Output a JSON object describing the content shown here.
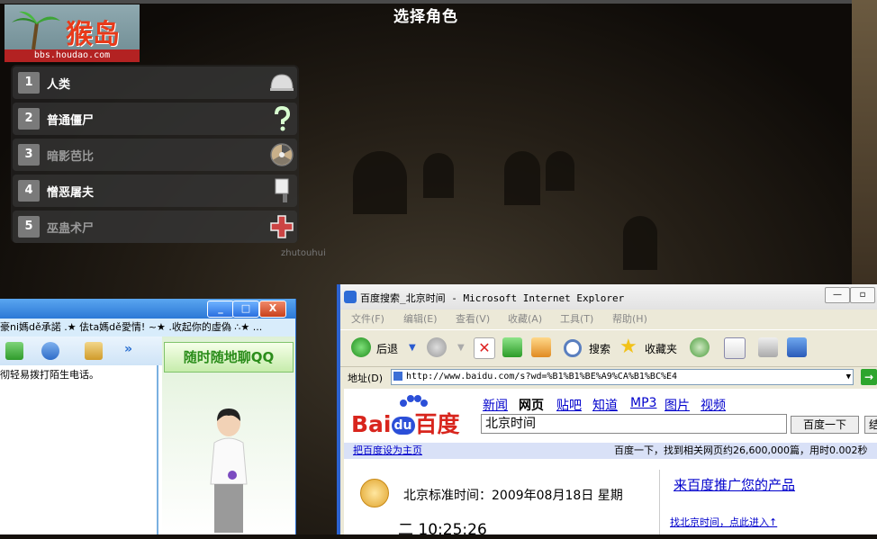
{
  "game": {
    "title": "选择角色",
    "logo_text": "猴岛",
    "logo_url": "bbs.houdao.com",
    "watermark": "zhutouhui",
    "menu": [
      {
        "num": "1",
        "label": "人类",
        "icon": "helmet-icon",
        "enabled": true
      },
      {
        "num": "2",
        "label": "普通僵尸",
        "icon": "question-icon",
        "enabled": true
      },
      {
        "num": "3",
        "label": "暗影芭比",
        "icon": "radiation-icon",
        "enabled": false
      },
      {
        "num": "4",
        "label": "憎恶屠夫",
        "icon": "cleaver-icon",
        "enabled": true
      },
      {
        "num": "5",
        "label": "巫蛊术尸",
        "icon": "cross-icon",
        "enabled": false
      }
    ]
  },
  "qq": {
    "marquee": "豪ni媽dě承諾 .★ 佉ta媽dě愛情! ~★ .收起你的虛偽 ∴★ ...",
    "body_text": "彻轻易拨打陌生电话。",
    "side_banner": "随时随地聊QQ",
    "minimize": "_",
    "maximize": "□",
    "close": "X",
    "more": "»"
  },
  "ie": {
    "title": "百度搜索_北京时间 - Microsoft Internet Explorer",
    "menu": [
      "文件(F)",
      "编辑(E)",
      "查看(V)",
      "收藏(A)",
      "工具(T)",
      "帮助(H)"
    ],
    "back_label": "后退",
    "search_label": "搜索",
    "favorites_label": "收藏夹",
    "address_label": "地址(D)",
    "address": "http://www.baidu.com/s?wd=%B1%B1%BE%A9%CA%B1%BC%E4",
    "go": "→"
  },
  "baidu": {
    "logo_bai": "Bai",
    "logo_du": "du",
    "logo_cn": "百度",
    "nav": [
      "新闻",
      "网页",
      "贴吧",
      "知道",
      "MP3",
      "图片",
      "视频"
    ],
    "query": "北京时间",
    "search_btn": "百度一下",
    "search_btn2": "结",
    "set_home": "把百度设为主页",
    "stats": "百度一下，找到相关网页约26,600,000篇，用时0.002秒",
    "time_line1": "北京标准时间：2009年08月18日 星期",
    "time_line2": "二 10:25:26",
    "promo": "来百度推广您的产品",
    "find_link": "找北京时间，点此进入↑"
  }
}
